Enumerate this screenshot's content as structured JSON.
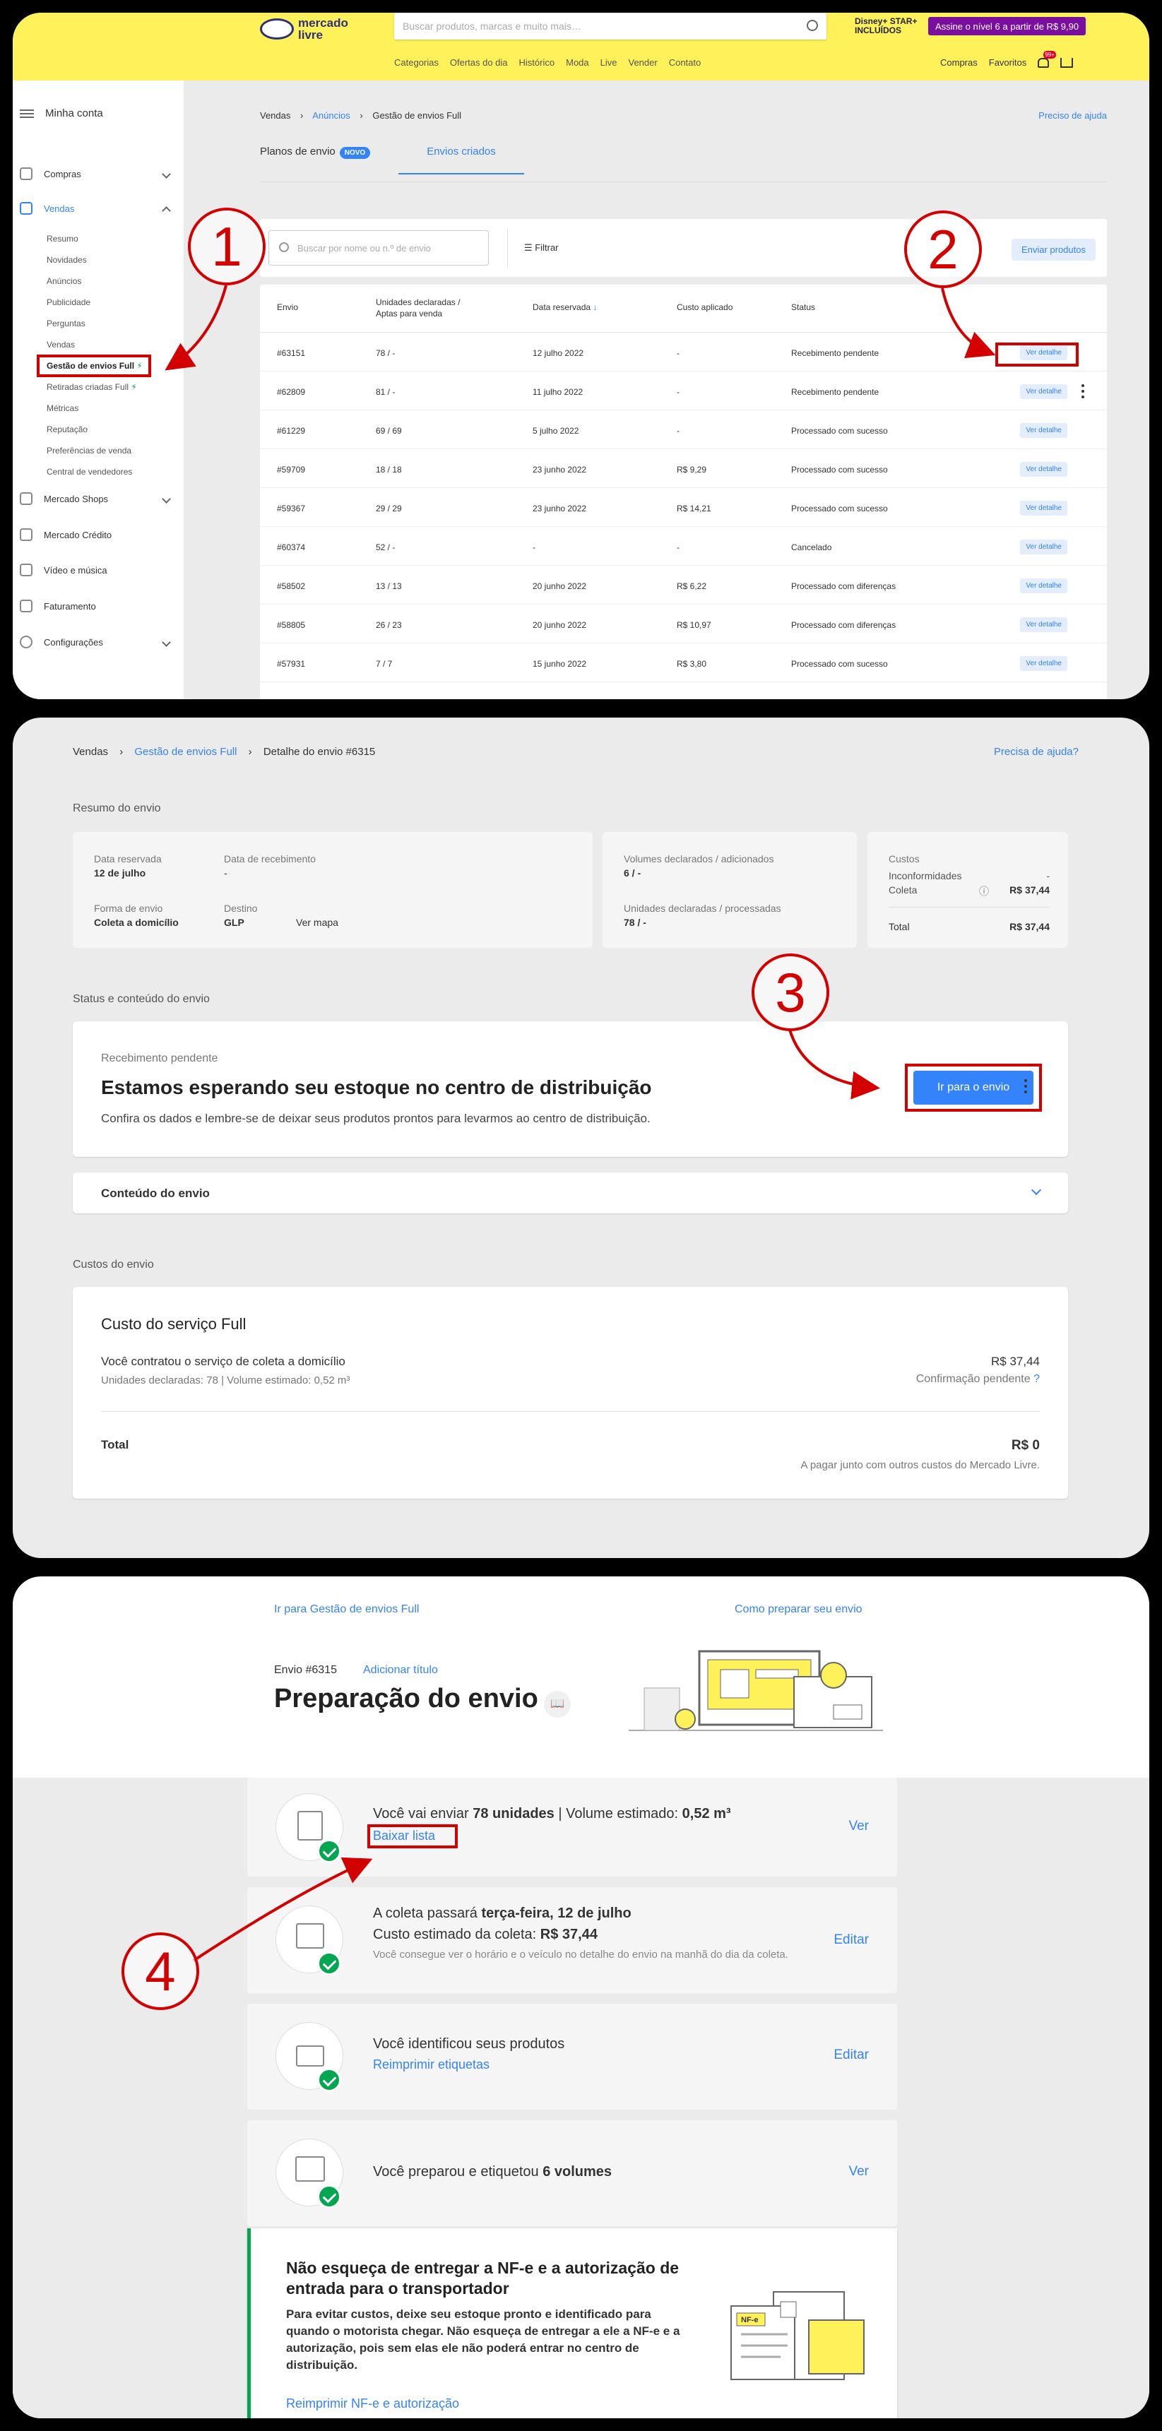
{
  "panel1": {
    "logo": "mercado livre",
    "search_placeholder": "Buscar produtos, marcas e muito mais…",
    "disney_badge": "Disney+ STAR+ INCLUÍDOS",
    "promo": "Assine o nível 6 a partir de R$ 9,90",
    "nav": [
      "Categorias",
      "Ofertas do dia",
      "Histórico",
      "Moda",
      "Live",
      "Vender",
      "Contato"
    ],
    "user_links": [
      "Compras",
      "Favoritos"
    ],
    "cart_badge": "99+",
    "sidebar": {
      "account": "Minha conta",
      "groups": [
        {
          "label": "Compras"
        },
        {
          "label": "Vendas"
        },
        {
          "label": "Mercado Shops"
        },
        {
          "label": "Mercado Crédito"
        },
        {
          "label": "Vídeo e música"
        },
        {
          "label": "Faturamento"
        },
        {
          "label": "Configurações"
        }
      ],
      "vendas_items": [
        "Resumo",
        "Novidades",
        "Anúncios",
        "Publicidade",
        "Perguntas",
        "Vendas",
        "Gestão de envios Full",
        "Retiradas criadas Full",
        "Métricas",
        "Reputação",
        "Preferências de venda",
        "Central de vendedores"
      ]
    },
    "breadcrumb": {
      "a": "Vendas",
      "b": "Anúncios",
      "c": "Gestão de envios Full"
    },
    "help": "Preciso de ajuda",
    "tabs": {
      "plans": "Planos de envio",
      "new_badge": "NOVO",
      "created": "Envios criados"
    },
    "search_box_placeholder": "Buscar por nome ou n.º de envio",
    "filter": "Filtrar",
    "send_products": "Enviar produtos",
    "table": {
      "headers": [
        "Envio",
        "Unidades declaradas / Aptas para venda",
        "Data reservada",
        "Custo aplicado",
        "Status"
      ],
      "action": "Ver detalhe",
      "rows": [
        [
          "#63151",
          "78 / -",
          "12 julho 2022",
          "-",
          "Recebimento pendente"
        ],
        [
          "#62809",
          "81 / -",
          "11 julho 2022",
          "-",
          "Recebimento pendente"
        ],
        [
          "#61229",
          "69 / 69",
          "5 julho 2022",
          "-",
          "Processado com sucesso"
        ],
        [
          "#59709",
          "18 / 18",
          "23 junho 2022",
          "R$ 9,29",
          "Processado com sucesso"
        ],
        [
          "#59367",
          "29 / 29",
          "23 junho 2022",
          "R$ 14,21",
          "Processado com sucesso"
        ],
        [
          "#60374",
          "52 / -",
          "-",
          "-",
          "Cancelado"
        ],
        [
          "#58502",
          "13 / 13",
          "20 junho 2022",
          "R$ 6,22",
          "Processado com diferenças"
        ],
        [
          "#58805",
          "26 / 23",
          "20 junho 2022",
          "R$ 10,97",
          "Processado com diferenças"
        ],
        [
          "#57931",
          "7 / 7",
          "15 junho 2022",
          "R$ 3,80",
          "Processado com sucesso"
        ]
      ]
    }
  },
  "panel2": {
    "breadcrumb": {
      "a": "Vendas",
      "b": "Gestão de envios Full",
      "c": "Detalhe do envio #6315"
    },
    "help": "Precisa de ajuda?",
    "summary_title": "Resumo do envio",
    "data_reservada_label": "Data reservada",
    "data_reservada": "12 de julho",
    "data_recebimento_label": "Data de recebimento",
    "data_recebimento": "-",
    "forma_label": "Forma de envio",
    "forma": "Coleta a domicílio",
    "destino_label": "Destino",
    "destino": "GLP",
    "ver_mapa": "Ver mapa",
    "volumes_label": "Volumes declarados / adicionados",
    "volumes": "6 / -",
    "unidades_label": "Unidades declaradas / processadas",
    "unidades": "78 / -",
    "custos_label": "Custos",
    "inconf_label": "Inconformidades",
    "inconf": "-",
    "coleta_label": "Coleta",
    "coleta": "R$ 37,44",
    "total_label": "Total",
    "total": "R$ 37,44",
    "status_title": "Status e conteúdo do envio",
    "status_small": "Recebimento pendente",
    "status_big": "Estamos esperando seu estoque no centro de distribuição",
    "status_desc": "Confira os dados e lembre-se de deixar seus produtos prontos para levarmos ao centro de distribuição.",
    "go_button": "Ir para o envio",
    "content_title": "Conteúdo do envio",
    "costs_title": "Custos do envio",
    "service_title": "Custo do serviço Full",
    "service_desc": "Você contratou o serviço de coleta a domicílio",
    "service_sub": "Unidades declaradas: 78 | Volume estimado: 0,52 m³",
    "service_value": "R$ 37,44",
    "service_confirm": "Confirmação pendente",
    "total2_label": "Total",
    "total2": "R$ 0",
    "total2_note": "A pagar junto com outros custos do Mercado Livre."
  },
  "panel3": {
    "back_link": "Ir para Gestão de envios Full",
    "how_link": "Como preparar seu envio",
    "envio_num": "Envio #6315",
    "add_title": "Adicionar título",
    "title": "Preparação do envio",
    "step1_a": "Você vai enviar ",
    "step1_b": "78 unidades",
    "step1_c": " | Volume estimado: ",
    "step1_d": "0,52 m³",
    "step1_link": "Baixar lista",
    "step1_action": "Ver",
    "step2_a": "A coleta passará ",
    "step2_b": "terça-feira, 12 de julho",
    "step2_c": "Custo estimado da coleta: ",
    "step2_d": "R$ 37,44",
    "step2_small": "Você consegue ver o horário e o veículo no detalhe do envio na manhã do dia da coleta.",
    "step2_action": "Editar",
    "step3": "Você identificou seus produtos",
    "step3_link": "Reimprimir etiquetas",
    "step3_action": "Editar",
    "step4_a": "Você preparou e etiquetou ",
    "step4_b": "6 volumes",
    "step4_action": "Ver",
    "nfe_title": "Não esqueça de entregar a NF-e e a autorização de entrada para o transportador",
    "nfe_desc": "Para evitar custos, deixe seu estoque pronto e identificado para quando o motorista chegar. Não esqueça de entregar a ele a NF-e e a autorização, pois sem elas ele não poderá entrar no centro de distribuição.",
    "nfe_link": "Reimprimir NF-e e autorização",
    "nfe_doc_label": "NF-e"
  },
  "annotations": [
    "1",
    "2",
    "3",
    "4"
  ],
  "colors": {
    "accent": "#3483fa",
    "header": "#fff159",
    "annotation": "#d30000",
    "success": "#00a650"
  }
}
